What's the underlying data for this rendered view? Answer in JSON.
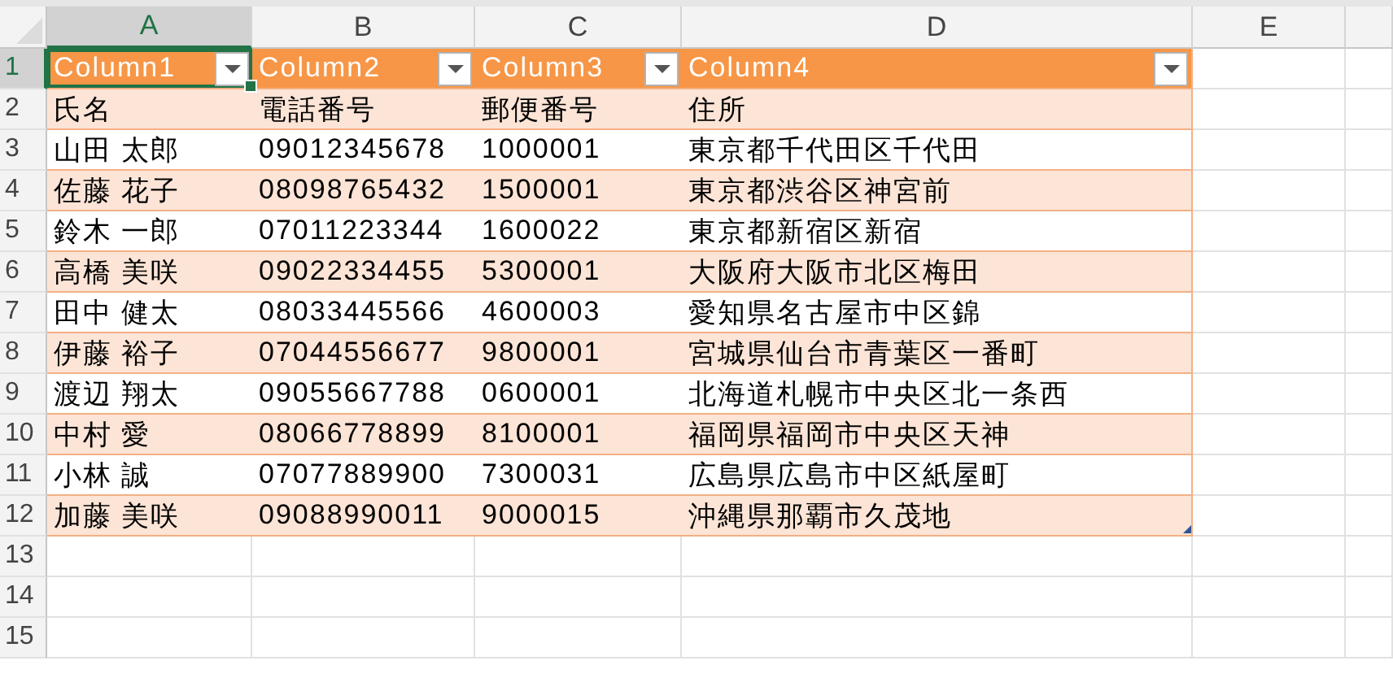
{
  "column_headers": [
    {
      "label": "A",
      "selected": true
    },
    {
      "label": "B",
      "selected": false
    },
    {
      "label": "C",
      "selected": false
    },
    {
      "label": "D",
      "selected": false
    },
    {
      "label": "E",
      "selected": false
    }
  ],
  "row_headers": [
    {
      "label": "1",
      "selected": true
    },
    {
      "label": "2",
      "selected": false
    },
    {
      "label": "3",
      "selected": false
    },
    {
      "label": "4",
      "selected": false
    },
    {
      "label": "5",
      "selected": false
    },
    {
      "label": "6",
      "selected": false
    },
    {
      "label": "7",
      "selected": false
    },
    {
      "label": "8",
      "selected": false
    },
    {
      "label": "9",
      "selected": false
    },
    {
      "label": "10",
      "selected": false
    },
    {
      "label": "11",
      "selected": false
    },
    {
      "label": "12",
      "selected": false
    },
    {
      "label": "13",
      "selected": false
    },
    {
      "label": "14",
      "selected": false
    },
    {
      "label": "15",
      "selected": false
    }
  ],
  "table": {
    "columns": [
      {
        "label": "Column1",
        "selected": true
      },
      {
        "label": "Column2",
        "selected": false
      },
      {
        "label": "Column3",
        "selected": false
      },
      {
        "label": "Column4",
        "selected": false
      }
    ],
    "rows": [
      [
        "氏名",
        "電話番号",
        "郵便番号",
        "住所"
      ],
      [
        "山田 太郎",
        "09012345678",
        "1000001",
        "東京都千代田区千代田"
      ],
      [
        "佐藤 花子",
        "08098765432",
        "1500001",
        "東京都渋谷区神宮前"
      ],
      [
        "鈴木 一郎",
        "07011223344",
        "1600022",
        "東京都新宿区新宿"
      ],
      [
        "高橋 美咲",
        "09022334455",
        "5300001",
        "大阪府大阪市北区梅田"
      ],
      [
        "田中 健太",
        "08033445566",
        "4600003",
        "愛知県名古屋市中区錦"
      ],
      [
        "伊藤 裕子",
        "07044556677",
        "9800001",
        "宮城県仙台市青葉区一番町"
      ],
      [
        "渡辺 翔太",
        "09055667788",
        "0600001",
        "北海道札幌市中央区北一条西"
      ],
      [
        "中村 愛",
        "08066778899",
        "8100001",
        "福岡県福岡市中央区天神"
      ],
      [
        "小林 誠",
        "07077889900",
        "7300031",
        "広島県広島市中区紙屋町"
      ],
      [
        "加藤 美咲",
        "09088990011",
        "9000015",
        "沖縄県那覇市久茂地"
      ]
    ]
  }
}
